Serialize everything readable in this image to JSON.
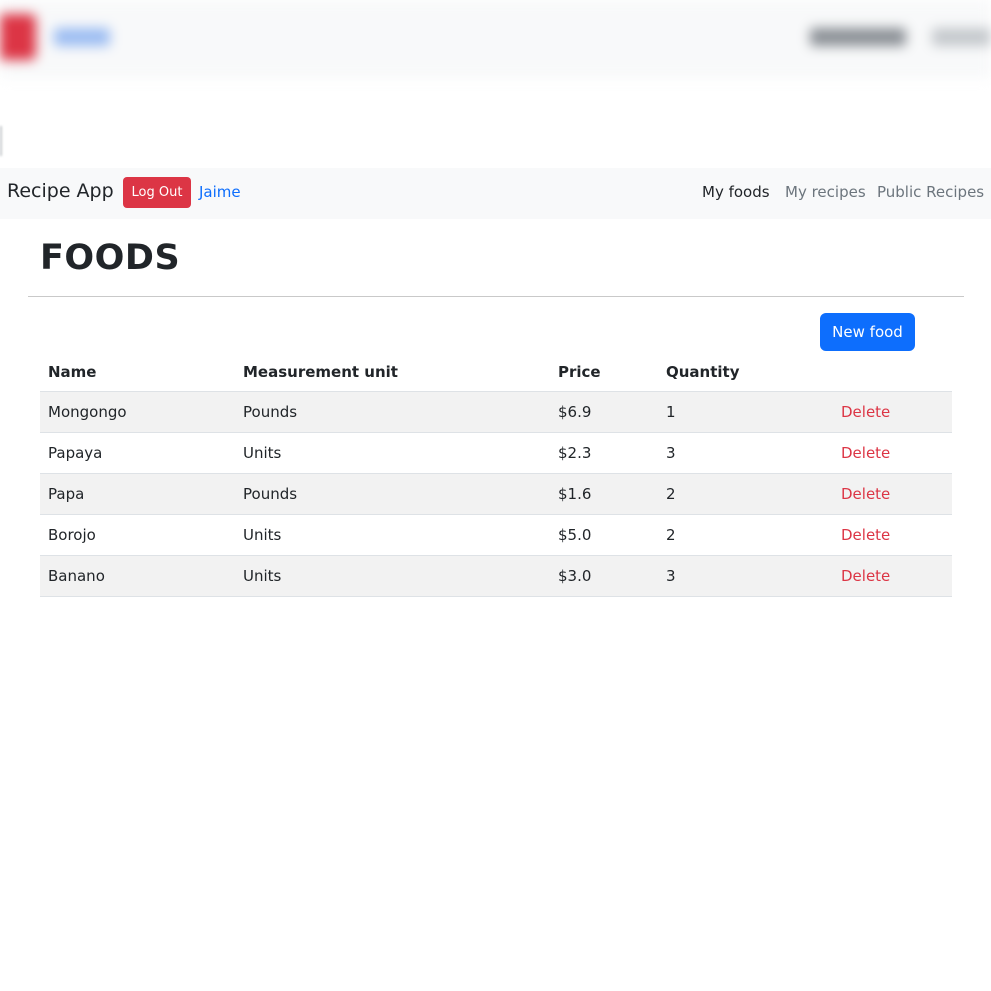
{
  "navbar": {
    "brand": "Recipe App",
    "logout_label": "Log Out",
    "user_name": "Jaime",
    "links": [
      {
        "label": "My foods",
        "active": true
      },
      {
        "label": "My recipes",
        "active": false
      },
      {
        "label": "Public Recipes",
        "active": false
      }
    ]
  },
  "page": {
    "title": "FOODS",
    "new_food_label": "New food"
  },
  "table": {
    "headers": [
      "Name",
      "Measurement unit",
      "Price",
      "Quantity",
      ""
    ],
    "rows": [
      {
        "name": "Mongongo",
        "unit": "Pounds",
        "price": "$6.9",
        "quantity": "1",
        "action": "Delete"
      },
      {
        "name": "Papaya",
        "unit": "Units",
        "price": "$2.3",
        "quantity": "3",
        "action": "Delete"
      },
      {
        "name": "Papa",
        "unit": "Pounds",
        "price": "$1.6",
        "quantity": "2",
        "action": "Delete"
      },
      {
        "name": "Borojo",
        "unit": "Units",
        "price": "$5.0",
        "quantity": "2",
        "action": "Delete"
      },
      {
        "name": "Banano",
        "unit": "Units",
        "price": "$3.0",
        "quantity": "3",
        "action": "Delete"
      }
    ]
  },
  "colors": {
    "danger": "#dc3545",
    "primary": "#0d6efd",
    "navbar_bg": "#f8f9fa",
    "stripe": "#f2f2f2"
  }
}
